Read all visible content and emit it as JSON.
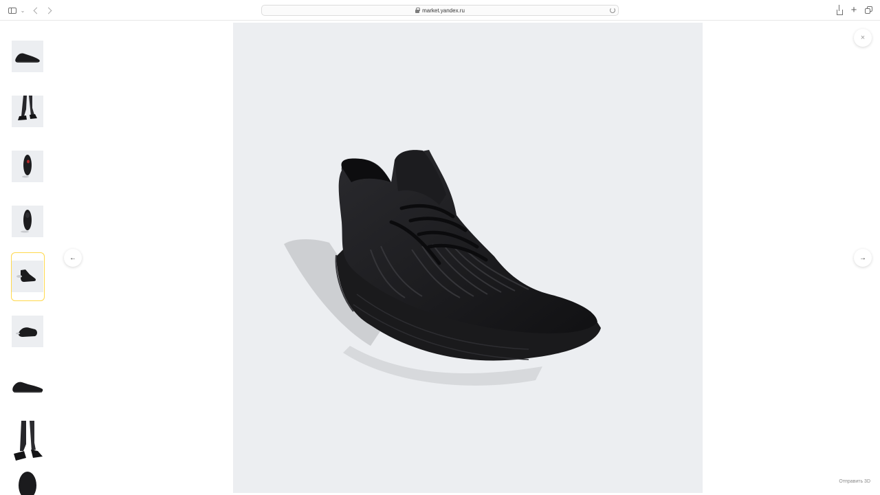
{
  "browser": {
    "url": "market.yandex.ru",
    "icons": {
      "sidebar": "sidebar-icon",
      "back": "chevron-left-icon",
      "forward": "chevron-right-icon",
      "lock": "lock-icon",
      "reload": "reload-icon",
      "share": "share-icon",
      "new_tab": "plus-icon",
      "tabs": "tabs-overview-icon"
    },
    "new_tab_glyph": "+"
  },
  "gallery": {
    "thumbnails": [
      {
        "name": "thumb-shoe-side"
      },
      {
        "name": "thumb-shoe-on-feet"
      },
      {
        "name": "thumb-shoe-sole-red"
      },
      {
        "name": "thumb-shoe-sole"
      },
      {
        "name": "thumb-shoe-front-selected"
      },
      {
        "name": "thumb-shoe-angle"
      },
      {
        "name": "thumb-shoe-profile"
      },
      {
        "name": "thumb-shoe-on-legs"
      },
      {
        "name": "thumb-shoe-top"
      }
    ],
    "selected_index": 4,
    "selected_color": "#ffd84a",
    "background_color": "#eceef1"
  },
  "controls": {
    "prev_glyph": "←",
    "next_glyph": "→",
    "close_glyph": "×"
  },
  "footer": {
    "send3d_label": "Отправить 3D"
  }
}
